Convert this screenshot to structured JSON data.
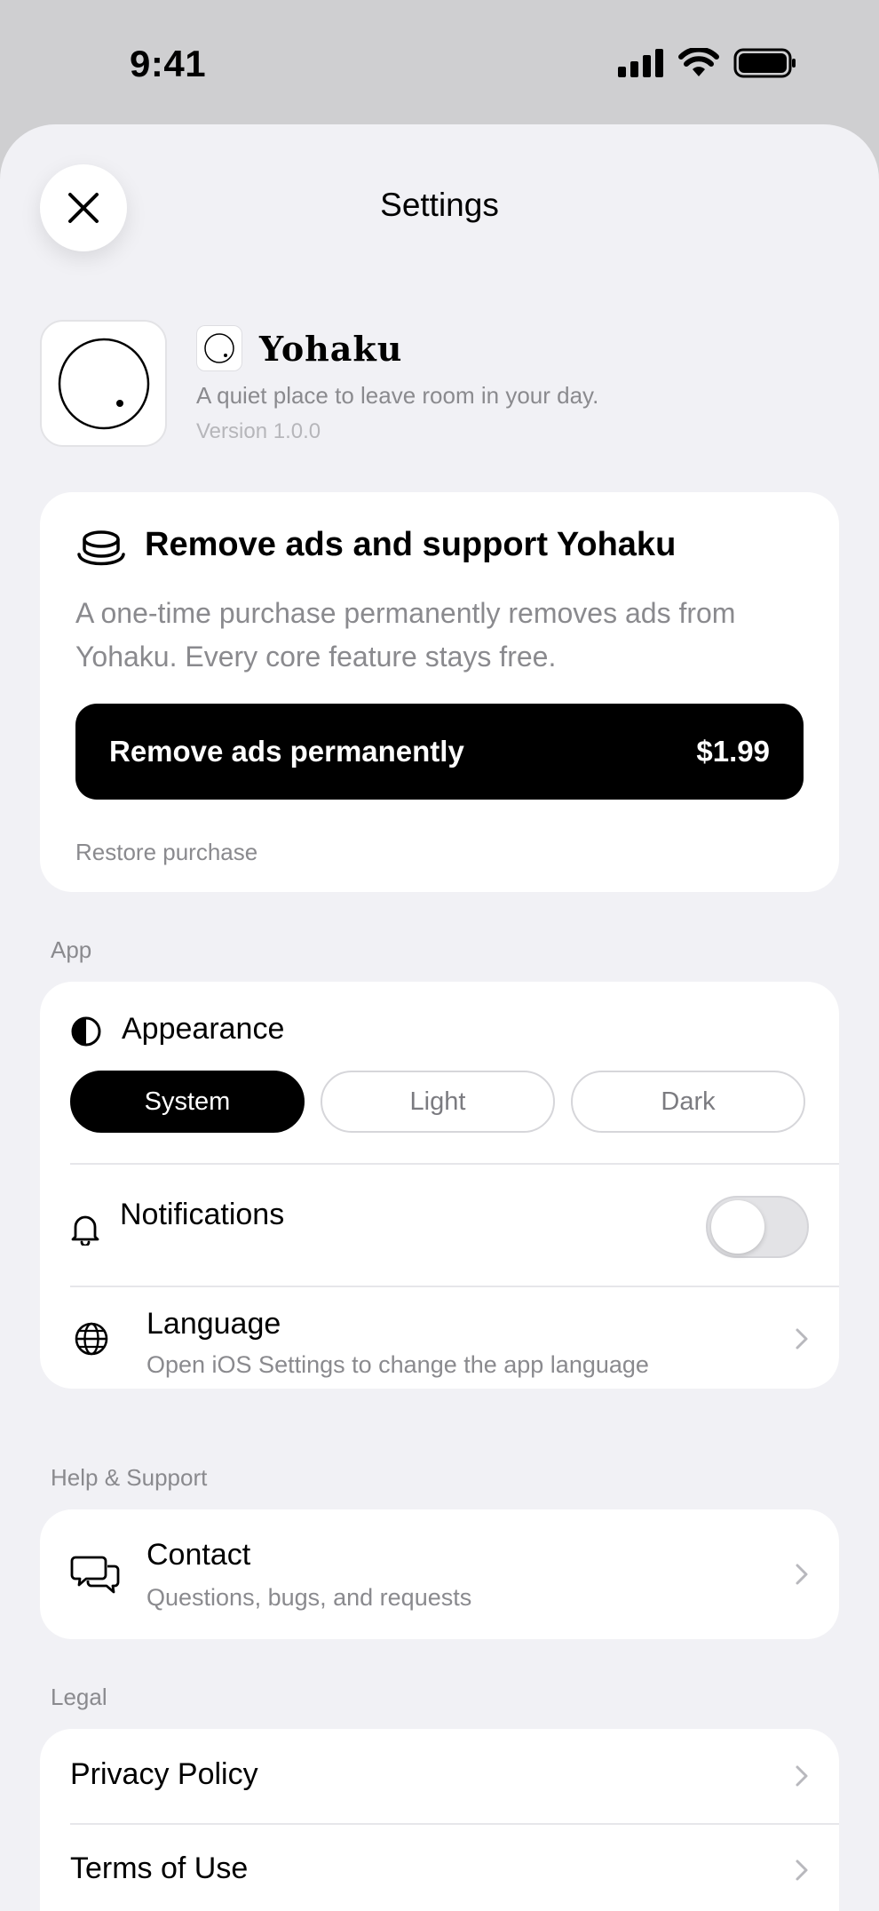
{
  "status_bar": {
    "time": "9:41"
  },
  "header": {
    "title": "Settings",
    "close_icon": "close-icon"
  },
  "app_info": {
    "name": "Yohaku",
    "tagline": "A quiet place to leave room in your day.",
    "version": "Version 1.0.0"
  },
  "promo": {
    "icon": "coffee-cup-icon",
    "title": "Remove ads and support Yohaku",
    "description": "A one-time purchase permanently removes ads from Yohaku. Every core feature stays free.",
    "button_label": "Remove ads permanently",
    "price": "$1.99",
    "restore_label": "Restore purchase"
  },
  "sections": {
    "app": {
      "label": "App",
      "appearance": {
        "label": "Appearance",
        "options": [
          "System",
          "Light",
          "Dark"
        ],
        "selected": "System"
      },
      "notifications": {
        "label": "Notifications",
        "enabled": false
      },
      "language": {
        "title": "Language",
        "subtitle": "Open iOS Settings to change the app language"
      }
    },
    "help": {
      "label": "Help & Support",
      "contact": {
        "title": "Contact",
        "subtitle": "Questions, bugs, and requests"
      }
    },
    "legal": {
      "label": "Legal",
      "items": [
        "Privacy Policy",
        "Terms of Use"
      ]
    }
  },
  "colors": {
    "accent": "#000000",
    "background": "#f1f1f5",
    "secondary_text": "#8a8a8e"
  }
}
